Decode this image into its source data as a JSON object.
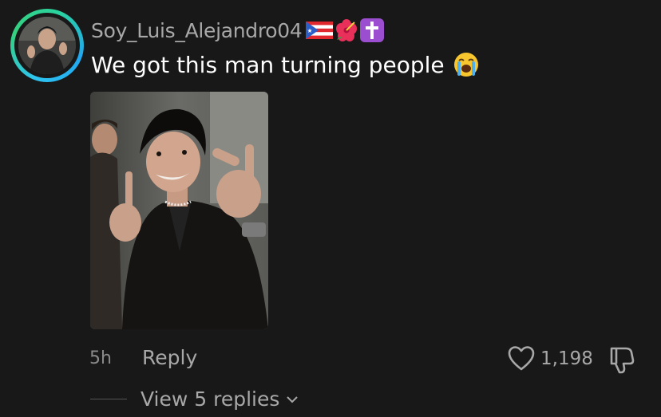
{
  "comment": {
    "username": "Soy_Luis_Alejandro04",
    "username_emojis": [
      "flag-puerto-rico-icon",
      "hibiscus-icon",
      "latin-cross-icon"
    ],
    "text": "We got this man turning people",
    "text_emoji": "loudly-crying-face-icon",
    "timestamp": "5h",
    "reply_label": "Reply",
    "like_count": "1,198",
    "view_replies_label": "View 5 replies"
  },
  "colors": {
    "background": "#181818",
    "username": "#a8a8a8",
    "text": "#ffffff",
    "ring_start": "#2ec4f0",
    "ring_end": "#35d07f"
  }
}
